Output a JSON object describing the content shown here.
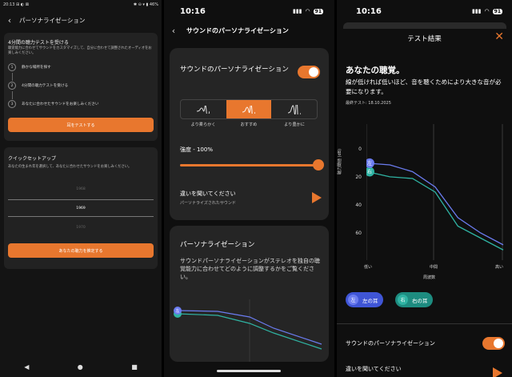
{
  "panel1": {
    "status": {
      "time": "20:13",
      "icons_left": "⊞ ◐ ⊠",
      "icons_right": "✱ ⊖ ▾ ▮ 46%"
    },
    "header": {
      "title": "パーソナライゼーション"
    },
    "test_card": {
      "title": "4分間の聴力テストを受ける",
      "description": "聴覚能力に合わせてサウンドをカスタマイズして、自分に合わせて調整されたオーディオをお楽しみください。",
      "steps": [
        {
          "num": "1",
          "label": "静かな場所を探す"
        },
        {
          "num": "2",
          "label": "4分間の聴力テストを受ける"
        },
        {
          "num": "3",
          "label": "あなたに合わせたサウンドをお楽しみください"
        }
      ],
      "button": "耳をテストする"
    },
    "quick_card": {
      "title": "クイックセットアップ",
      "description": "あなたの生まれ年を選択して、あなたに合わせたサウンドをお楽しみください。",
      "years": [
        "1968",
        "1969",
        "1970"
      ],
      "button": "あなたの聴力を推定する"
    },
    "nav": {
      "back": "◀",
      "home": "●",
      "recent": "■"
    }
  },
  "panel2": {
    "status": {
      "time": "10:16",
      "signal": "▮▮▮",
      "wifi": "◠",
      "battery": "91"
    },
    "header": {
      "title": "サウンドのパーソナライゼーション"
    },
    "sound_card": {
      "title": "サウンドのパーソナライゼーション",
      "toggle_on": true,
      "options": [
        "より柔らかく",
        "おすすめ",
        "より豊かに"
      ],
      "selected": 1,
      "strength_label": "強度 - 100%",
      "strength": 1.0,
      "listen_title": "違いを聞いてください",
      "listen_sub": "パーソナライズされたサウンド"
    },
    "info_card": {
      "title": "パーソナライゼーション",
      "description": "サウンドパーソナライゼーションがステレオを独自の聴覚能力に合わせてどのように調整するかをご覧ください。",
      "marker": "左"
    }
  },
  "panel3": {
    "status": {
      "time": "10:16",
      "battery": "91"
    },
    "header": {
      "title": "テスト結果",
      "close": "✕"
    },
    "hearing_title": "あなたの聴覚。",
    "hearing_desc": "線が低ければ低いほど、音を聴くためにより大きな音が必要になります。",
    "last_test": "最終テスト: 18.10.2025",
    "chart_data": {
      "type": "line",
      "x": [
        "低い",
        "中間",
        "高い"
      ],
      "xlabel": "周波数",
      "ylabel": "聴力閾値 (dB)",
      "yticks": [
        "0",
        "20",
        "40",
        "60"
      ],
      "ylim": [
        -10,
        70
      ],
      "series": [
        {
          "name": "左の耳",
          "color": "#6b7cf0",
          "values": [
            13,
            14,
            18,
            27,
            45,
            54,
            61
          ]
        },
        {
          "name": "右の耳",
          "color": "#2fb3a3",
          "values": [
            18,
            21,
            22,
            30,
            50,
            57,
            64
          ]
        }
      ]
    },
    "legend": [
      {
        "badge": "左",
        "label": "左の耳",
        "color": "#6b7cf0"
      },
      {
        "badge": "右",
        "label": "右の耳",
        "color": "#2fb3a3"
      }
    ],
    "personalization_label": "サウンドのパーソナライゼーション",
    "listen_label": "違いを聞いてください"
  }
}
